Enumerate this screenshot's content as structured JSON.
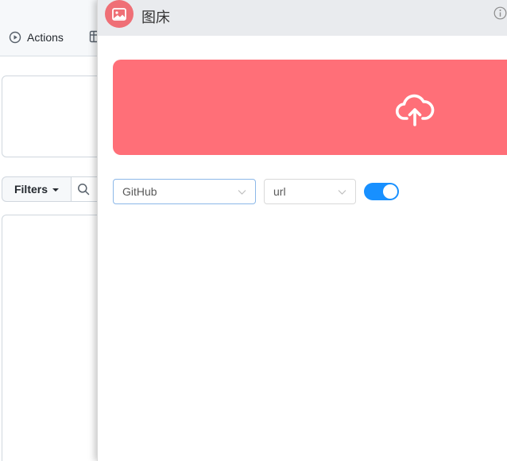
{
  "background_page": {
    "tabs": [
      {
        "label": "Actions",
        "icon": "play-circle-icon"
      }
    ],
    "filters_label": "Filters",
    "search_icon": "search-icon"
  },
  "panel": {
    "title": "图床",
    "logo_icon": "image-icon",
    "info_icon": "info-icon",
    "upload": {
      "icon": "cloud-upload-icon",
      "color": "#ff6f78"
    },
    "host_select": {
      "value": "GitHub"
    },
    "format_select": {
      "value": "url"
    },
    "toggle": {
      "on": true,
      "color": "#1890ff"
    }
  }
}
